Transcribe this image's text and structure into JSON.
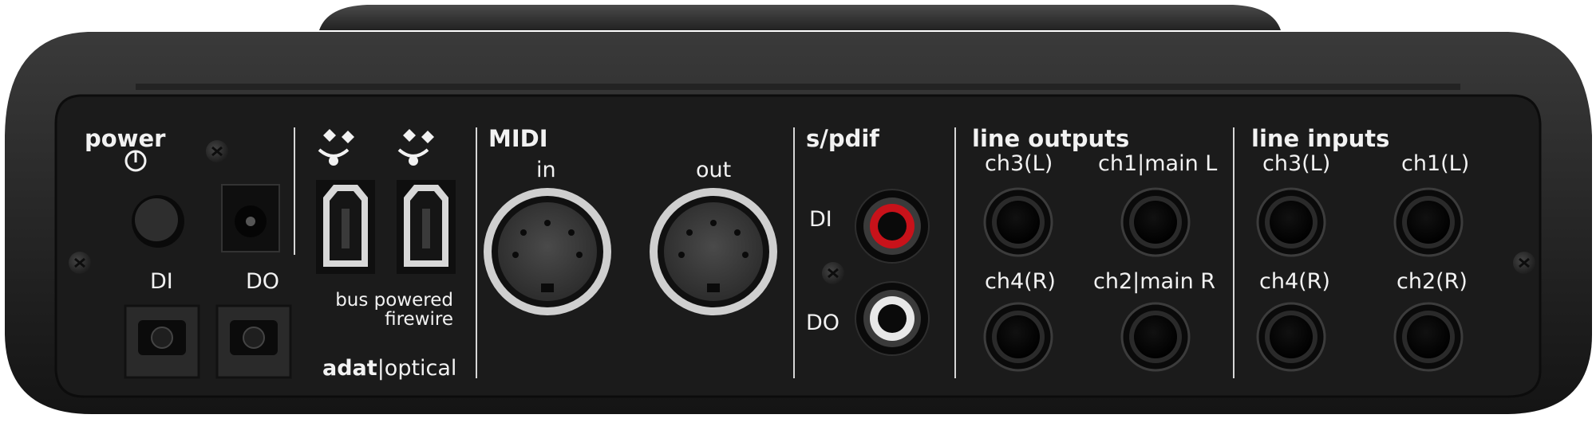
{
  "device": {
    "body_color": "#2b2b2b",
    "panel_color": "#1c1c1c",
    "label_color": "#f2f2f2",
    "rca_red": "#c8121a",
    "rca_white": "#e8e8e8"
  },
  "power": {
    "heading": "power",
    "icon": "power-symbol-icon"
  },
  "adat": {
    "di": "DI",
    "do": "DO",
    "brand_bold": "adat",
    "brand_sep": "|",
    "brand_light": "optical"
  },
  "firewire": {
    "icon": "firewire-icon",
    "caption_line1": "bus powered",
    "caption_line2": "firewire"
  },
  "midi": {
    "heading": "MIDI",
    "in": "in",
    "out": "out"
  },
  "spdif": {
    "heading": "s/pdif",
    "di": "DI",
    "do": "DO"
  },
  "line_outputs": {
    "heading": "line outputs",
    "ch3": "ch3(L)",
    "ch1": "ch1|main L",
    "ch4": "ch4(R)",
    "ch2": "ch2|main R"
  },
  "line_inputs": {
    "heading": "line inputs",
    "ch3": "ch3(L)",
    "ch1": "ch1(L)",
    "ch4": "ch4(R)",
    "ch2": "ch2(R)"
  }
}
